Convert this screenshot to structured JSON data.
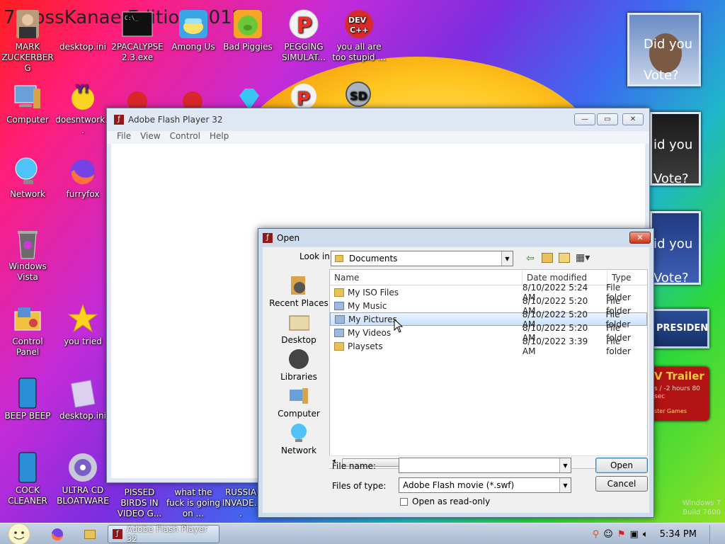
{
  "desktop": {
    "title": "7 BossKanae Edition 2012",
    "icons": [
      {
        "label": "MARK ZUCKERBERG"
      },
      {
        "label": "desktop.ini"
      },
      {
        "label": "2PACALYPSE 2.3.exe"
      },
      {
        "label": "Among Us"
      },
      {
        "label": "Bad Piggies"
      },
      {
        "label": "PEGGING SIMULAT..."
      },
      {
        "label": "you all are too stupid ..."
      },
      {
        "label": "Computer"
      },
      {
        "label": "doesntwork..."
      },
      {
        "label": "Network"
      },
      {
        "label": "furryfox"
      },
      {
        "label": "Windows Vista"
      },
      {
        "label": "Control Panel"
      },
      {
        "label": "you tried"
      },
      {
        "label": "BEEP BEEP"
      },
      {
        "label": "desktop.ini"
      },
      {
        "label": "COCK CLEANER"
      },
      {
        "label": "ULTRA CD BLOATWARE"
      },
      {
        "label": "PISSED BIRDS IN VIDEO G..."
      },
      {
        "label": "what the fuck is going on ..."
      },
      {
        "label": "RUSSIA INVADE..."
      }
    ],
    "gadgets": {
      "vote1": "Did you Vote?",
      "vote2": "id you Vote?",
      "vote3": "id you Vote?",
      "president": "PRESIDENT",
      "trailer": "V Trailer",
      "trailer_sub": "s / -2 hours 80 sec",
      "trailer_small": "ster Games"
    },
    "watermark_line1": "Windows 7",
    "watermark_line2": "Build 7600"
  },
  "flash_window": {
    "title": "Adobe Flash Player 32",
    "menu": [
      "File",
      "View",
      "Control",
      "Help"
    ]
  },
  "open_dialog": {
    "title": "Open",
    "look_in_label": "Look in:",
    "look_in_value": "Documents",
    "places": [
      "Recent Places",
      "Desktop",
      "Libraries",
      "Computer",
      "Network"
    ],
    "columns": [
      "Name",
      "Date modified",
      "Type"
    ],
    "rows": [
      {
        "name": "My ISO Files",
        "date": "8/10/2022 5:24 AM",
        "type": "File folder"
      },
      {
        "name": "My Music",
        "date": "8/10/2022 5:20 AM",
        "type": "File folder"
      },
      {
        "name": "My Pictures",
        "date": "8/10/2022 5:20 AM",
        "type": "File folder"
      },
      {
        "name": "My Videos",
        "date": "8/10/2022 5:20 AM",
        "type": "File folder"
      },
      {
        "name": "Playsets",
        "date": "8/10/2022 3:39 AM",
        "type": "File folder"
      }
    ],
    "file_name_label": "File name:",
    "file_name_value": "",
    "files_of_type_label": "Files of type:",
    "files_of_type_value": "Adobe Flash movie (*.swf)",
    "read_only_label": "Open as read-only",
    "open_button": "Open",
    "cancel_button": "Cancel"
  },
  "taskbar": {
    "app_label": "Adobe Flash Player 32",
    "clock": "5:34 PM"
  }
}
